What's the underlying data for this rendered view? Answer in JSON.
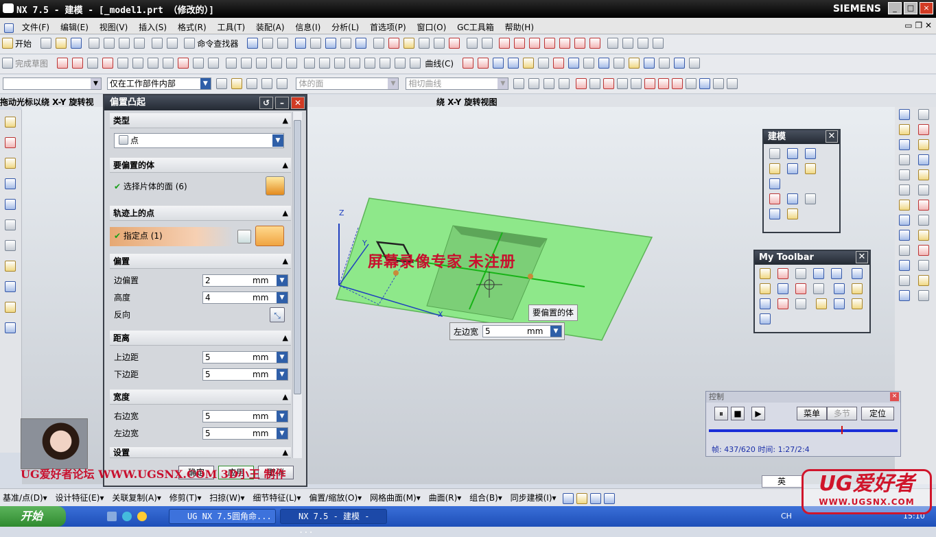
{
  "window": {
    "title": "NX 7.5 - 建模 - [_model1.prt （修改的）]",
    "brand": "SIEMENS"
  },
  "menubar": [
    "文件(F)",
    "编辑(E)",
    "视图(V)",
    "插入(S)",
    "格式(R)",
    "工具(T)",
    "装配(A)",
    "信息(I)",
    "分析(L)",
    "首选项(P)",
    "窗口(O)",
    "GC工具箱",
    "帮助(H)"
  ],
  "toolbar1": {
    "start": "开始",
    "command_finder": "命令查找器"
  },
  "toolbar2": {
    "finish_sketch": "完成草图",
    "curve": "曲线(C)"
  },
  "selection_bar": {
    "filter_value": "",
    "scope_value": "仅在工作部件内部",
    "body_face": "体的面",
    "tangent_curve": "相切曲线"
  },
  "cue_left": "拖动光标以绕 X-Y 旋转视",
  "cue_right": "绕 X-Y 旋转视图",
  "dialog": {
    "title": "偏置凸起",
    "type_section": "类型",
    "type_value": "点",
    "body_section": "要偏置的体",
    "body_selected": "选择片体的面 (6)",
    "point_section": "轨迹上的点",
    "point_selected": "指定点 (1)",
    "offset_section": "偏置",
    "edge_offset_label": "边偏置",
    "edge_offset_value": "2",
    "height_label": "高度",
    "height_value": "4",
    "reverse_label": "反向",
    "distance_section": "距离",
    "top_label": "上边距",
    "top_value": "5",
    "bottom_label": "下边距",
    "bottom_value": "5",
    "width_section": "宽度",
    "right_label": "右边宽",
    "right_value": "5",
    "left_label": "左边宽",
    "left_value": "5",
    "settings_section": "设置",
    "unit": "mm",
    "ok": "确定",
    "apply": "应用",
    "cancel": "取消"
  },
  "viewport": {
    "watermark": "屏幕录像专家  未注册",
    "tooltip_body": "要偏置的体",
    "left_width_label": "左边宽",
    "left_width_value": "5",
    "unit": "mm",
    "axes": [
      "Z",
      "Y",
      "X"
    ]
  },
  "palette_modeling": {
    "title": "建模"
  },
  "palette_mytoolbar": {
    "title": "My Toolbar"
  },
  "control": {
    "title": "控制",
    "menu_btn": "菜单",
    "multi_btn": "多节",
    "locate_btn": "定位",
    "status": "帧: 437/620 时间: 1:27/2:4"
  },
  "bottom_toolbar": [
    "基准/点(D)▾",
    "设计特征(E)▾",
    "关联复制(A)▾",
    "修剪(T)▾",
    "扫掠(W)▾",
    "细节特征(L)▾",
    "偏置/缩放(O)▾",
    "网格曲面(M)▾",
    "曲面(R)▾",
    "组合(B)▾",
    "同步建模(I)▾"
  ],
  "ime": "英",
  "forum_text": "UG爱好者论坛 WWW.UGSNX.COM 3D小王 制作",
  "logo": {
    "main": "UG爱好者",
    "url": "WWW.UGSNX.COM"
  },
  "taskbar": {
    "start": "开始",
    "tasks": [
      "UG NX 7.5圆角命...",
      "NX 7.5 - 建模 - ..."
    ],
    "lang": "CH",
    "clock": "15:10"
  }
}
